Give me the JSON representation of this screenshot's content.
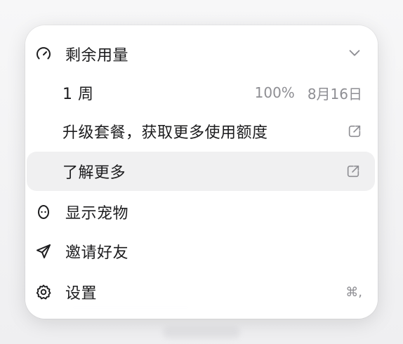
{
  "menu": {
    "usage": {
      "label": "剩余用量",
      "icon": "gauge-icon",
      "chevron": "chevron-down-icon"
    },
    "usage_detail": {
      "period": "1 周",
      "percent": "100%",
      "reset_date": "8月16日"
    },
    "upgrade": {
      "label": "升级套餐，获取更多使用额度",
      "icon": "external-link-icon"
    },
    "learn_more": {
      "label": "了解更多",
      "icon": "external-link-icon"
    },
    "show_pet": {
      "label": "显示宠物",
      "icon": "pet-egg-icon"
    },
    "invite": {
      "label": "邀请好友",
      "icon": "paper-plane-icon"
    },
    "settings": {
      "label": "设置",
      "icon": "gear-icon",
      "shortcut": "⌘,"
    }
  },
  "colors": {
    "text": "#1c1c1e",
    "secondary": "#8e8e93",
    "hover": "#f0f0f1",
    "menu_bg": "#ffffff"
  }
}
